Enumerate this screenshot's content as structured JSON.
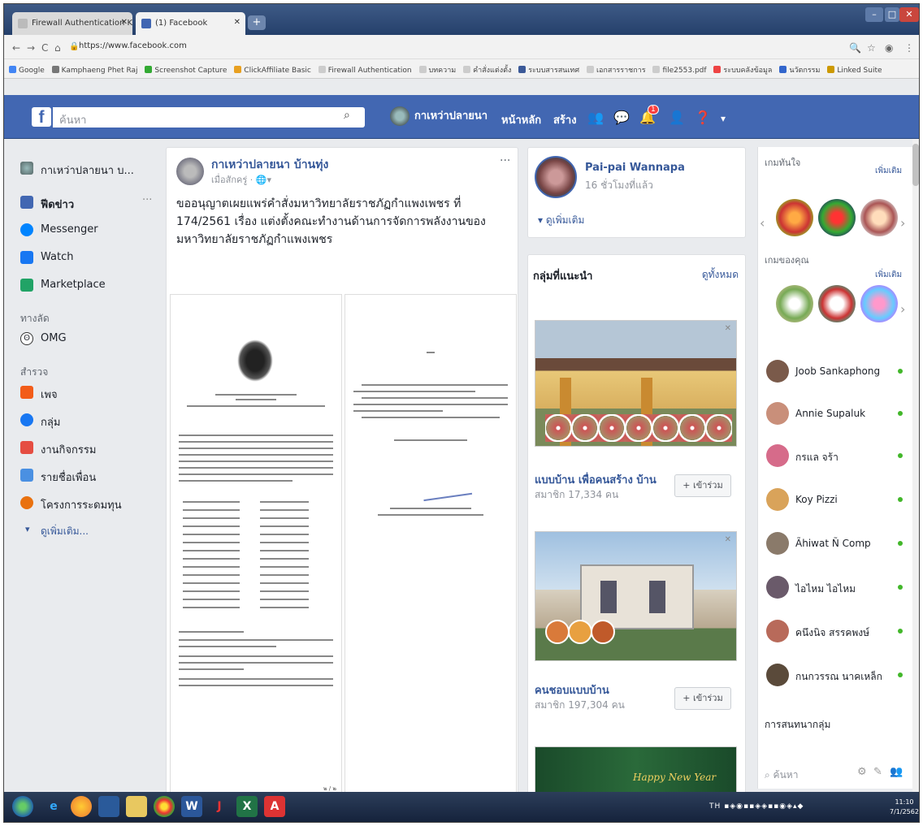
{
  "browser": {
    "tabs": [
      {
        "label": "Firewall Authentication Keepalive"
      },
      {
        "label": "(1) Facebook"
      }
    ],
    "url": "https://www.facebook.com",
    "bookmarks": [
      "Google",
      "Kamphaeng Phet Raj",
      "Screenshot Capture",
      "ClickAffiliate Basic",
      "Firewall Authentication",
      "บทความ",
      "คำสั่งแต่งตั้ง",
      "ระบบสารสนเทศ",
      "เอกสารราชการ",
      "file2553.pdf",
      "ระบบคลังข้อมูล",
      "นวัตกรรม",
      "Linked Suite"
    ]
  },
  "fb": {
    "search_placeholder": "ค้นหา",
    "profile_name": "กาเหว่าปลายนา",
    "nav_home": "หน้าหลัก",
    "nav_create": "สร้าง",
    "notif_count": "1"
  },
  "leftnav": {
    "profile": "กาเหว่าปลายนา บ...",
    "items": [
      {
        "label": "ฟีดข่าว",
        "icon": "newsfeed-icon",
        "color": "#4267b2"
      },
      {
        "label": "Messenger",
        "icon": "messenger-icon",
        "color": "#0084ff"
      },
      {
        "label": "Watch",
        "icon": "watch-icon",
        "color": "#1877f2"
      },
      {
        "label": "Marketplace",
        "icon": "marketplace-icon",
        "color": "#21a366"
      }
    ],
    "shortcuts_heading": "ทางลัด",
    "shortcuts": [
      {
        "label": "OMG",
        "icon": "omg-icon"
      }
    ],
    "explore_heading": "สำรวจ",
    "explore": [
      {
        "label": "เพจ",
        "icon": "flag-icon",
        "color": "#f25c19"
      },
      {
        "label": "กลุ่ม",
        "icon": "groups-icon",
        "color": "#1877f2"
      },
      {
        "label": "งานกิจกรรม",
        "icon": "events-icon",
        "color": "#e54d42"
      },
      {
        "label": "รายชื่อเพื่อน",
        "icon": "friends-icon",
        "color": "#4a90e2"
      },
      {
        "label": "โครงการระดมทุน",
        "icon": "fundraiser-icon",
        "color": "#e9710f"
      }
    ],
    "see_more": "ดูเพิ่มเติม..."
  },
  "post": {
    "author": "กาเหว่าปลายนา บ้านทุ่ง",
    "meta": "เมื่อสักครู่ · 🌐▾",
    "text": "ขออนุญาตเผยแพร่คำสั่งมหาวิทยาลัยราชภัฏกำแพงเพชร ที่ 174/2561 เรื่อง แต่งตั้งคณะทำงานด้านการจัดการพลังงานของมหาวิทยาลัยราชภัฏกำแพงเพชร",
    "doc_label": "๒ / ๒"
  },
  "profile_card": {
    "name": "Pai-pai Wannapa",
    "time": "16 ชั่วโมงที่แล้ว",
    "more": "ดูเพิ่มเติม"
  },
  "groups": {
    "title": "กลุ่มที่แนะนำ",
    "see_all": "ดูทั้งหมด",
    "join_label": "+ เข้าร่วม",
    "items": [
      {
        "name": "แบบบ้าน เพื่อคนสร้าง บ้าน",
        "members": "สมาชิก 17,334 คน"
      },
      {
        "name": "คนชอบแบบบ้าน",
        "members": "สมาชิก 197,304 คน"
      }
    ],
    "banner_text": "Happy New Year"
  },
  "right": {
    "games_heading": "เกมทันใจ",
    "your_games": "เกมของคุณ",
    "more": "เพิ่มเติม",
    "contacts": [
      {
        "name": "Joob Sankaphong",
        "color": "#7a5a4a"
      },
      {
        "name": "Annie Supaluk",
        "color": "#c98f7a"
      },
      {
        "name": "กรแล จร้า",
        "color": "#d66b8a"
      },
      {
        "name": "Koy Pizzi",
        "color": "#d9a35a"
      },
      {
        "name": "Ãhiwat Ñ Comp",
        "color": "#8a7a6a"
      },
      {
        "name": "ไอไหม ไอไหม",
        "color": "#6a5a6a"
      },
      {
        "name": "คนึงนิจ สรรคพงษ์",
        "color": "#b86a5a"
      },
      {
        "name": "กนกวรรณ นาคเหล็ก",
        "color": "#5a4a3a"
      }
    ],
    "group_chat": "การสนทนากลุ่ม",
    "chat_search": "ค้นหา"
  },
  "taskbar": {
    "time": "11:10",
    "date": "7/1/2562",
    "tray": "TH"
  }
}
